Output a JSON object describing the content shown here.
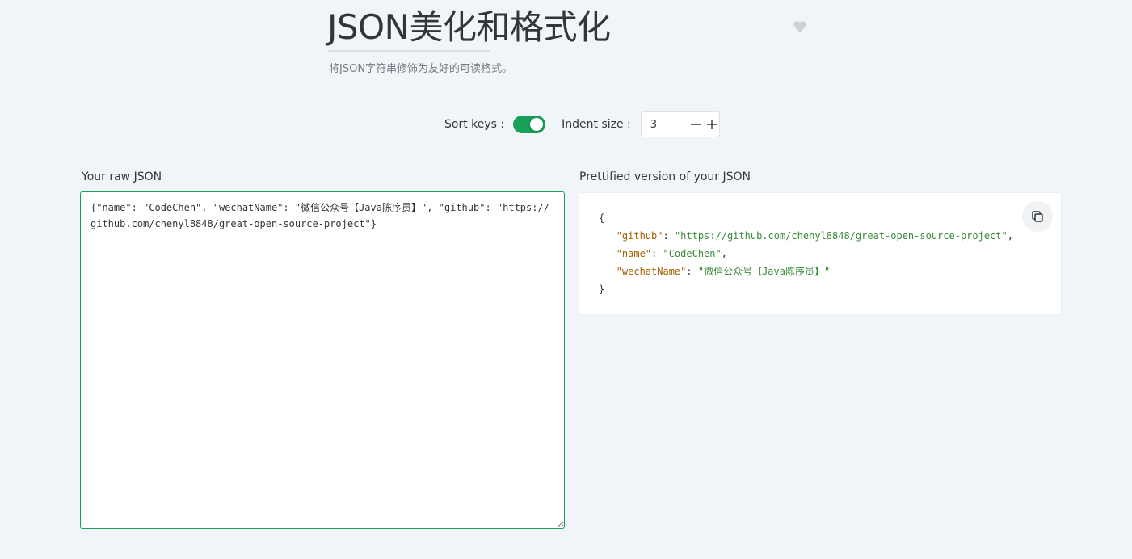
{
  "header": {
    "title": "JSON美化和格式化",
    "subtitle": "将JSON字符串修饰为友好的可读格式。"
  },
  "icons": {
    "favorite": "heart-icon",
    "copy": "copy-icon",
    "minus": "minus-icon",
    "plus": "plus-icon"
  },
  "options": {
    "sort_keys_label": "Sort keys :",
    "sort_keys_enabled": true,
    "indent_size_label": "Indent size :",
    "indent_size_value": "3"
  },
  "raw_panel": {
    "label": "Your raw JSON",
    "value": "{\"name\": \"CodeChen\", \"wechatName\": \"微信公众号【Java陈序员】\", \"github\": \"https://github.com/chenyl8848/great-open-source-project\"}"
  },
  "pretty_panel": {
    "label": "Prettified version of your JSON",
    "lines": [
      {
        "indent": "",
        "open": "{"
      },
      {
        "indent": "   ",
        "key": "\"github\"",
        "sep": ": ",
        "value": "\"https://github.com/chenyl8848/great-open-source-project\"",
        "comma": ","
      },
      {
        "indent": "   ",
        "key": "\"name\"",
        "sep": ": ",
        "value": "\"CodeChen\"",
        "comma": ","
      },
      {
        "indent": "   ",
        "key": "\"wechatName\"",
        "sep": ": ",
        "value": "\"微信公众号【Java陈序员】\"",
        "comma": ""
      },
      {
        "indent": "",
        "open": "}"
      }
    ]
  },
  "colors": {
    "accent": "#18a058",
    "json_key": "#a65e00",
    "json_string": "#3a8a3a",
    "background": "#f1f4f8"
  }
}
